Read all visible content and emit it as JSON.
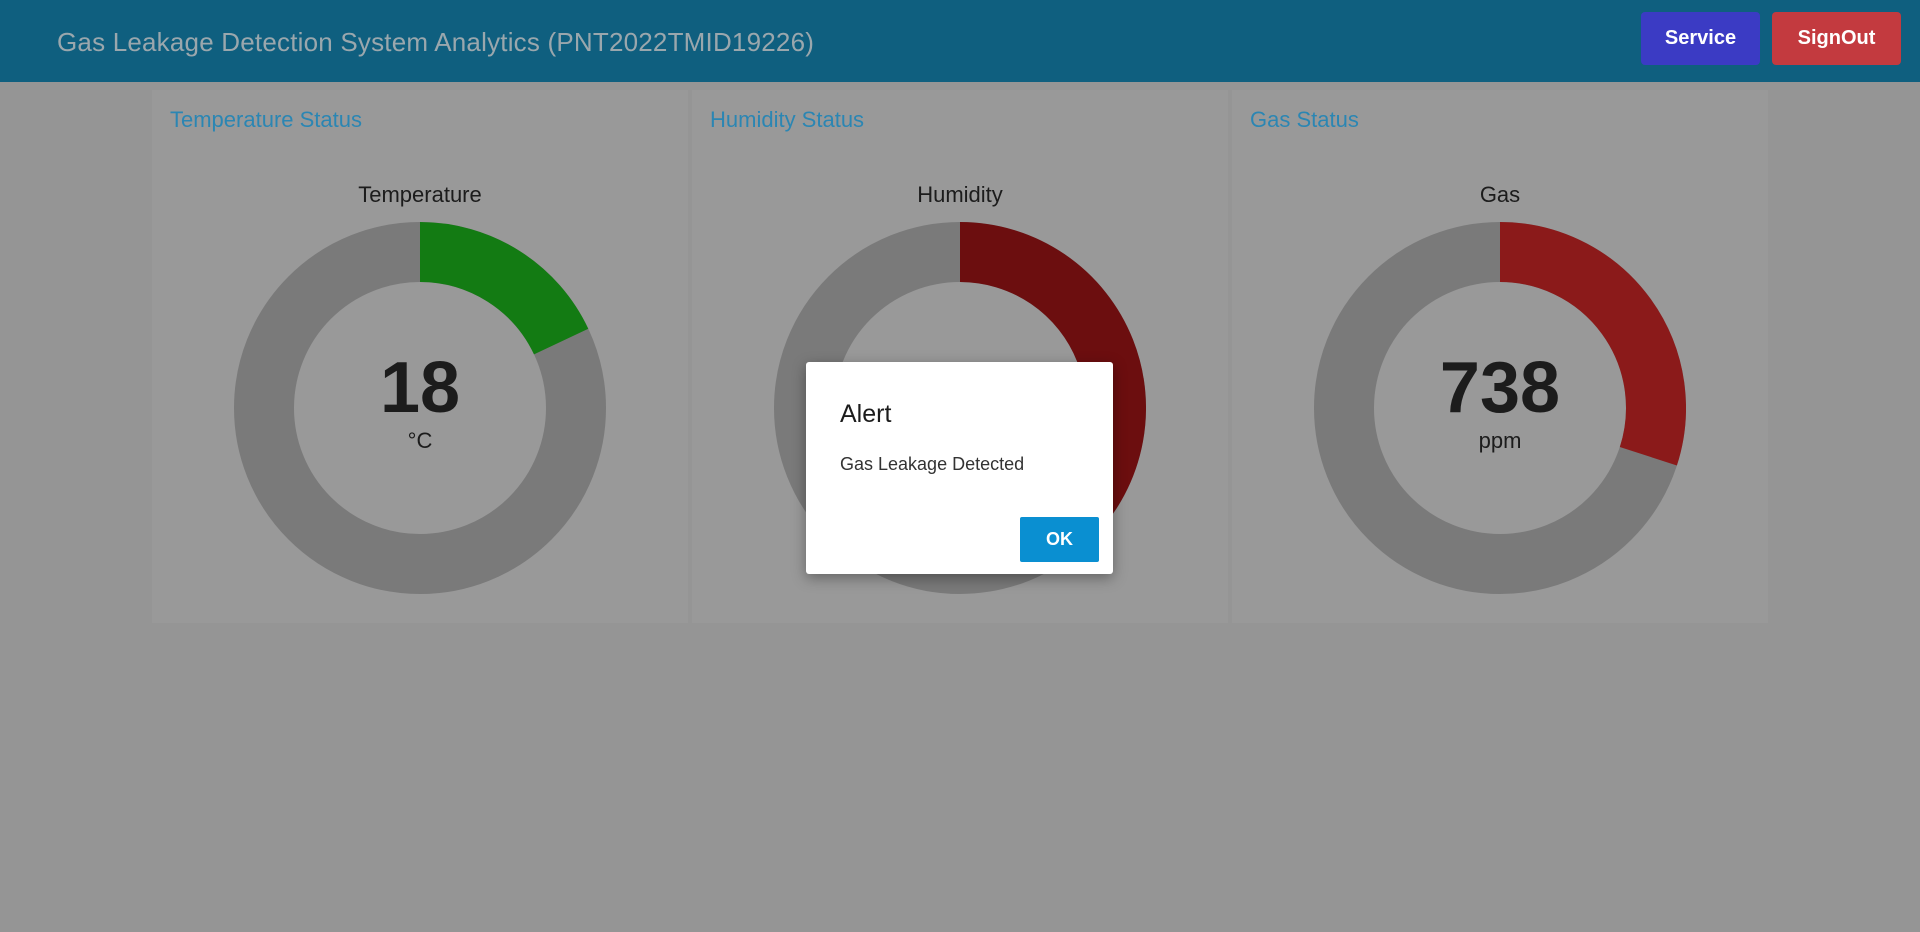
{
  "header": {
    "title": "Gas Leakage Detection System Analytics (PNT2022TMID19226)",
    "service_label": "Service",
    "signout_label": "SignOut"
  },
  "cards": [
    {
      "title": "Temperature Status",
      "gauge_label": "Temperature",
      "value": "18",
      "unit": "°C",
      "fraction": 0.18,
      "color": "#137b13"
    },
    {
      "title": "Humidity Status",
      "gauge_label": "Humidity",
      "value": "",
      "unit": "",
      "fraction": 0.38,
      "color": "#6c0e0f"
    },
    {
      "title": "Gas Status",
      "gauge_label": "Gas",
      "value": "738",
      "unit": "ppm",
      "fraction": 0.3,
      "color": "#8b1a1a"
    }
  ],
  "gauge_track_color": "#7a7a7a",
  "gauge_center_color": "#999999",
  "dialog": {
    "title": "Alert",
    "message": "Gas Leakage Detected",
    "ok_label": "OK"
  }
}
